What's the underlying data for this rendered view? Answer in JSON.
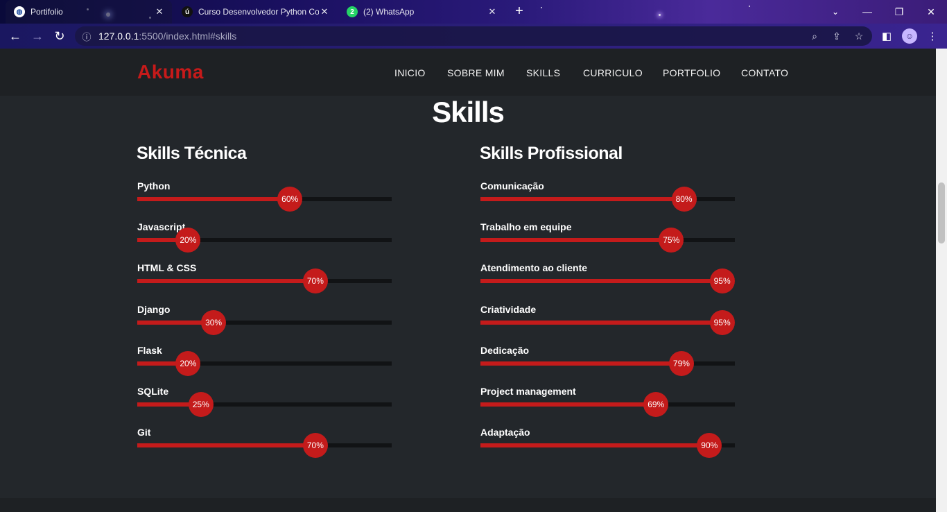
{
  "browser": {
    "tabs": [
      {
        "title": "Portifolio",
        "active": true
      },
      {
        "title": "Curso Desenvolvedor Python Co",
        "active": false
      },
      {
        "title": "(2) WhatsApp",
        "active": false
      }
    ],
    "whatsapp_badge": "2",
    "url_host": "127.0.0.1",
    "url_path": ":5500/index.html#skills"
  },
  "site": {
    "logo": "Akuma",
    "menu": [
      "INICIO",
      "SOBRE MIM",
      "SKILLS",
      "CURRICULO",
      "PORTFOLIO",
      "CONTATO"
    ]
  },
  "section_title": "Skills",
  "columns": [
    {
      "title": "Skills Técnica",
      "skills": [
        {
          "name": "Python",
          "percent": 60,
          "label": "60%"
        },
        {
          "name": "Javascript",
          "percent": 20,
          "label": "20%"
        },
        {
          "name": "HTML & CSS",
          "percent": 70,
          "label": "70%"
        },
        {
          "name": "Django",
          "percent": 30,
          "label": "30%"
        },
        {
          "name": "Flask",
          "percent": 20,
          "label": "20%"
        },
        {
          "name": "SQLite",
          "percent": 25,
          "label": "25%"
        },
        {
          "name": "Git",
          "percent": 70,
          "label": "70%"
        }
      ]
    },
    {
      "title": "Skills Profissional",
      "skills": [
        {
          "name": "Comunicação",
          "percent": 80,
          "label": "80%"
        },
        {
          "name": "Trabalho em equipe",
          "percent": 75,
          "label": "75%"
        },
        {
          "name": "Atendimento ao cliente",
          "percent": 95,
          "label": "95%"
        },
        {
          "name": "Criatividade",
          "percent": 95,
          "label": "95%"
        },
        {
          "name": "Dedicação",
          "percent": 79,
          "label": "79%"
        },
        {
          "name": "Project management",
          "percent": 69,
          "label": "69%"
        },
        {
          "name": "Adaptação",
          "percent": 90,
          "label": "90%"
        }
      ]
    }
  ],
  "colors": {
    "accent": "#c41b1b",
    "background": "#23272b",
    "header": "#1e2124",
    "track": "#111315"
  }
}
